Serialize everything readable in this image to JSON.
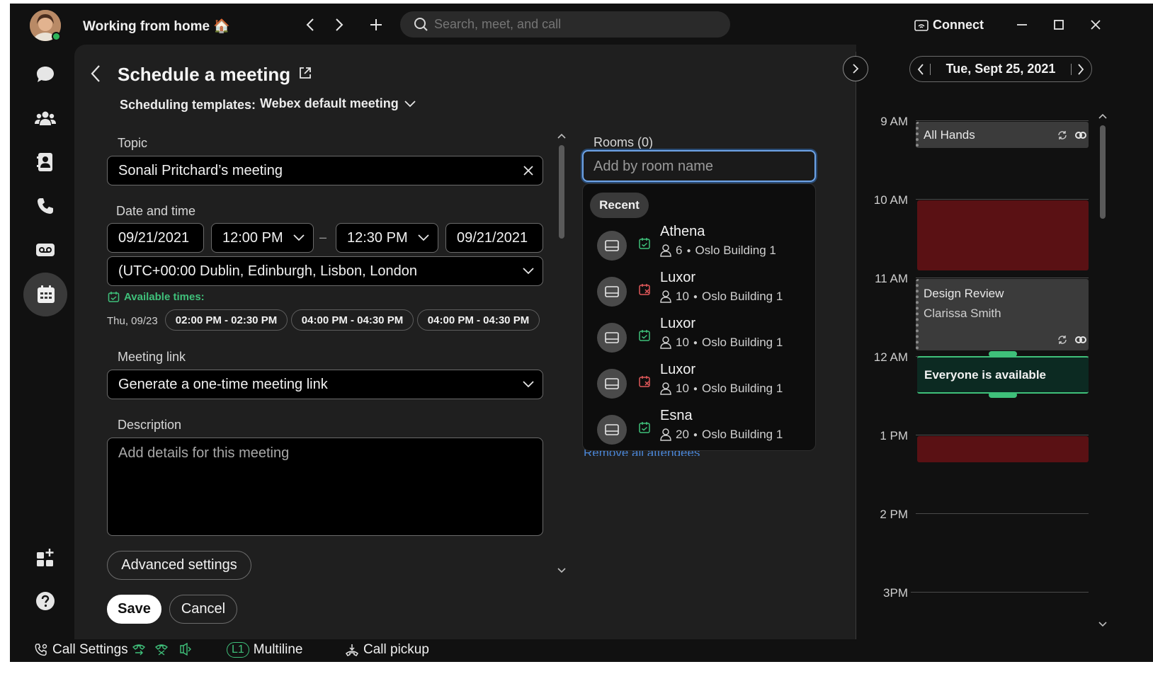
{
  "app": {
    "status_title": "Working from home 🏠",
    "search_placeholder": "Search, meet, and call",
    "connect_label": "Connect"
  },
  "form": {
    "page_title": "Schedule a meeting",
    "templates_label": "Scheduling templates:",
    "template_value": "Webex default meeting",
    "topic_label": "Topic",
    "topic_value": "Sonali Pritchard’s meeting",
    "datetime_label": "Date and time",
    "start_date": "09/21/2021",
    "start_time": "12:00 PM",
    "dash": "–",
    "end_time": "12:30 PM",
    "end_date": "09/21/2021",
    "timezone": "(UTC+00:00 Dublin, Edinburgh, Lisbon, London",
    "available_label": "Available times:",
    "available_day": "Thu, 09/23",
    "available_slots": [
      "02:00 PM - 02:30 PM",
      "04:00 PM - 04:30 PM",
      "04:00 PM - 04:30 PM"
    ],
    "meeting_link_label": "Meeting link",
    "meeting_link_value": "Generate a one-time meeting link",
    "description_label": "Description",
    "description_placeholder": "Add details for this meeting",
    "advanced_label": "Advanced settings",
    "save_label": "Save",
    "cancel_label": "Cancel"
  },
  "rooms": {
    "label": "Rooms (0)",
    "input_placeholder": "Add by room name",
    "recent_label": "Recent",
    "list": [
      {
        "name": "Athena",
        "capacity": "6",
        "building": "Oslo Building 1",
        "status": "available"
      },
      {
        "name": "Luxor",
        "capacity": "10",
        "building": "Oslo Building 1",
        "status": "busy"
      },
      {
        "name": "Luxor",
        "capacity": "10",
        "building": "Oslo Building 1",
        "status": "available"
      },
      {
        "name": "Luxor",
        "capacity": "10",
        "building": "Oslo Building 1",
        "status": "busy"
      },
      {
        "name": "Esna",
        "capacity": "20",
        "building": "Oslo Building 1",
        "status": "available"
      }
    ],
    "hidden_link": "Remove all attendees"
  },
  "calendar": {
    "date_label": "Tue, Sept 25, 2021",
    "hours": [
      "9 AM",
      "10 AM",
      "11 AM",
      "12 AM",
      "1 PM",
      "2 PM",
      "3PM"
    ],
    "events": {
      "all_hands": "All Hands",
      "design_review_title": "Design Review",
      "design_review_owner": "Clarissa Smith",
      "everyone_available": "Everyone is available"
    }
  },
  "statusbar": {
    "call_settings": "Call Settings",
    "line_badge": "L1",
    "multiline": "Multiline",
    "call_pickup": "Call pickup"
  },
  "colors": {
    "background": "#111111",
    "panel": "#1f1f1f",
    "accent_blue": "#6ea3e6",
    "available_green": "#3fc07a",
    "busy_red": "#e0585a",
    "busy_block": "#5a1114",
    "available_block": "#0c2a22"
  }
}
